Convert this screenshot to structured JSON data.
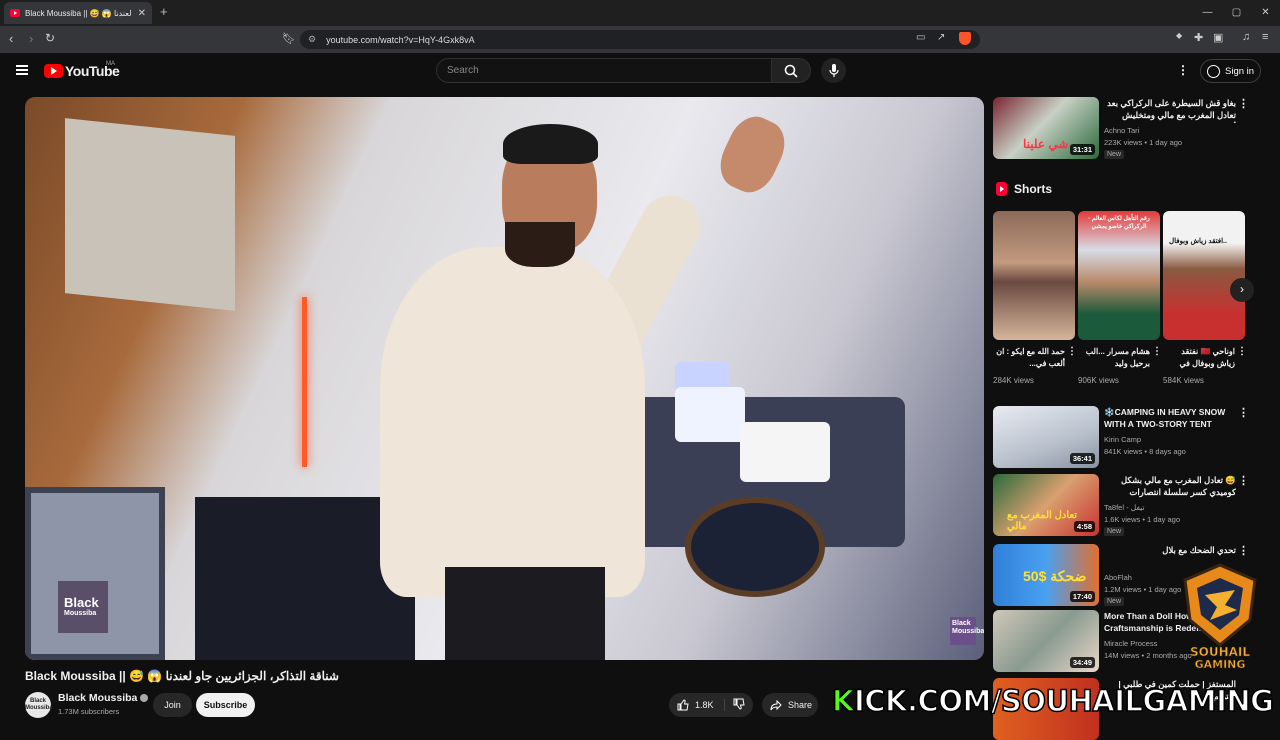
{
  "browser": {
    "tab_title": "Black Moussiba || 😅 😱 لعندنا",
    "new_tab": "+",
    "url": "youtube.com/watch?v=HqY-4Gxk8vA",
    "window_controls": [
      "—",
      "▢",
      "✕"
    ]
  },
  "header": {
    "logo": "YouTube",
    "country": "MA",
    "search_placeholder": "Search",
    "signin": "Sign in"
  },
  "video": {
    "title": "Black Moussiba || 😅 😱 شناقة التذاكر، الجزائريين جاو لعندنا",
    "watermark_line1": "Black",
    "watermark_line2": "Moussiba",
    "corner_badge": "Black Moussiba",
    "channel": "Black Moussiba",
    "channel_avatar": "Black Moussiba",
    "subscribers": "1.73M subscribers",
    "join": "Join",
    "subscribe": "Subscribe",
    "likes": "1.8K",
    "share": "Share"
  },
  "related": [
    {
      "title": "بغاو قش السيطرة على الركراكي بعد تعادل المغرب مع مالي ومتخليش أشمو اللو ليه",
      "channel": "Achno Tari",
      "meta": "223K views • 1 day ago",
      "badge": "New",
      "duration": "31:31",
      "thumb_text": "شي علينا"
    },
    {
      "title": "❄️CAMPING IN HEAVY SNOW WITH A TWO-STORY TENT",
      "channel": "Kirin Camp",
      "meta": "841K views • 8 days ago",
      "badge": "",
      "duration": "36:41",
      "thumb_text": ""
    },
    {
      "title": "😅 تعادل المغرب مع مالي بشكل كوميدي كسر سلسلة انتصارات المغرب",
      "channel": "Ta8fel - تيفل",
      "meta": "1.6K views • 1 day ago",
      "badge": "New",
      "duration": "4:58",
      "thumb_text": "تعادل المغرب مع مالي"
    },
    {
      "title": "تحدي الضحك مع بلال",
      "channel": "AboFlah",
      "meta": "1.2M views • 1 day ago",
      "badge": "New",
      "duration": "17:40",
      "thumb_text": "ضحكة $50"
    },
    {
      "title": "More Than a Doll How Craftsmanship is Redefined",
      "channel": "Miracle Process",
      "meta": "14M views • 2 months ago",
      "badge": "",
      "duration": "34:49",
      "thumb_text": ""
    },
    {
      "title": "المستفز | حملت كمين في طلبي | ستريم",
      "channel": "",
      "meta": "",
      "badge": "",
      "duration": "",
      "thumb_text": ""
    }
  ],
  "shorts": {
    "heading": "Shorts",
    "items": [
      {
        "title": "حمد الله مع ايكو : ان ألعب في...",
        "views": "284K views",
        "thumb_text": ""
      },
      {
        "title": "هشام مسرار ...الب برحيل وليد",
        "views": "906K views",
        "thumb_text": "رقم التأهل لكاس العالم · الركراكي خاصو يمشي"
      },
      {
        "title": "اوناحي 🇲🇦 نفتقد زياش وبوفال في",
        "views": "584K views",
        "thumb_text": "افتقد زياش وبوفال.."
      }
    ]
  },
  "overlay": {
    "brand_line1": "SOUHAIL",
    "brand_line2": "GAMING",
    "kick_prefix": "K",
    "kick_rest": "ICK.COM/SOUHAILGAMING"
  },
  "colors": {
    "youtube_red": "#ff0000",
    "kick_green": "#53fc18",
    "bg": "#0f0f0f"
  }
}
